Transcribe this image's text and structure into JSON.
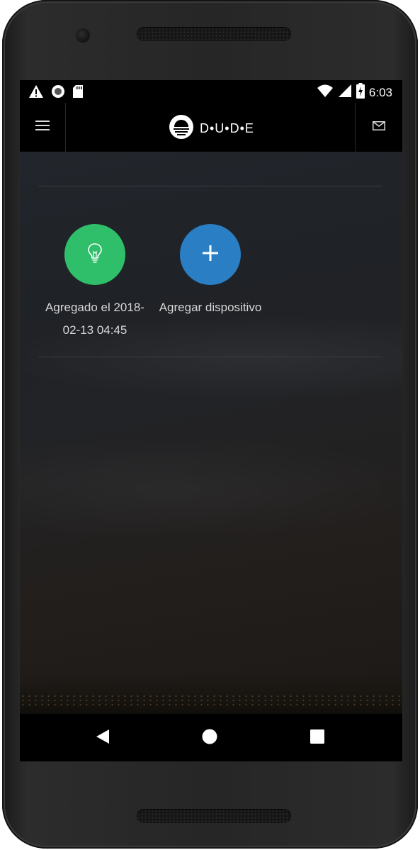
{
  "status_bar": {
    "time": "6:03",
    "icons": [
      "warning-icon",
      "circle-icon",
      "sd-card-icon",
      "wifi-icon",
      "signal-icon",
      "battery-charging-icon"
    ]
  },
  "app_bar": {
    "brand_text": "D•U•D•E",
    "menu_icon": "hamburger-menu-icon",
    "mail_icon": "mail-icon"
  },
  "devices": [
    {
      "label": "Agregado el 2018-02-13 04:45",
      "icon": "lightbulb-icon",
      "color": "#2fbf6a"
    },
    {
      "label": "Agregar dispositivo",
      "icon": "plus-icon",
      "color": "#2a7ec3"
    }
  ],
  "nav_bar": {
    "buttons": [
      "back-icon",
      "home-icon",
      "recents-icon"
    ]
  }
}
